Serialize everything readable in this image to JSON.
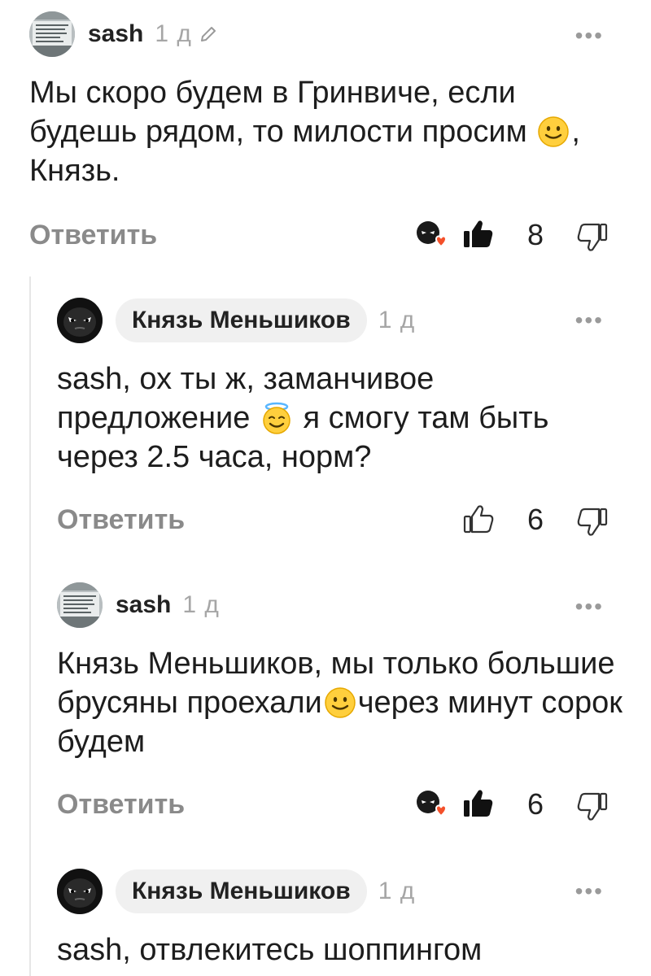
{
  "comments": [
    {
      "author": "sash",
      "time": "1 д",
      "more": "•••",
      "text_parts": [
        "Мы скоро будем в Гринвиче, если будешь рядом, то милости просим ",
        ", Князь."
      ],
      "reply": "Ответить",
      "likes": "8"
    },
    {
      "author": "Князь Меньшиков",
      "time": "1 д",
      "more": "•••",
      "text_parts": [
        "sash, ох ты ж, заманчивое предложение ",
        " я смогу там быть через 2.5 часа, норм?"
      ],
      "reply": "Ответить",
      "likes": "6"
    },
    {
      "author": "sash",
      "time": "1 д",
      "more": "•••",
      "text_parts": [
        "Князь Меньшиков, мы только большие брусяны проехали",
        "через минут сорок будем"
      ],
      "reply": "Ответить",
      "likes": "6"
    },
    {
      "author": "Князь Меньшиков",
      "time": "1 д",
      "more": "•••",
      "text_parts": [
        "sash, отвлекитесь шоппингом",
        ""
      ]
    }
  ],
  "icons": {
    "edit": "pencil-icon",
    "like_filled": "thumbs-up-filled-icon",
    "like_outline": "thumbs-up-outline-icon",
    "dislike": "thumbs-down-outline-icon",
    "reaction": "reaction-avatar-heart-icon",
    "emoji_smile": "slightly-smiling-face-emoji",
    "emoji_halo": "smiling-face-with-halo-emoji"
  },
  "colors": {
    "reply_text": "#8a8a8a",
    "time_text": "#a6a6a6",
    "author_pill_bg": "#f0f0f0",
    "heart": "#f4502a"
  }
}
